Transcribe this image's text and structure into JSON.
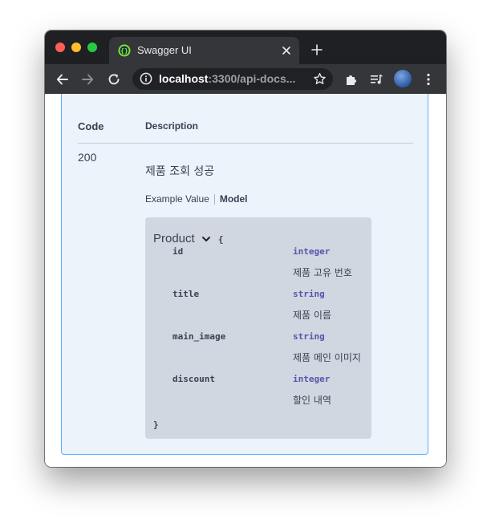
{
  "browser": {
    "tab_title": "Swagger UI",
    "url_host": "localhost",
    "url_path": ":3300/api-docs..."
  },
  "responses": {
    "header_code": "Code",
    "header_description": "Description",
    "status_code": "200",
    "description": "제품 조회 성공",
    "tab_example": "Example Value",
    "tab_model": "Model"
  },
  "model": {
    "name": "Product",
    "open_brace": "{",
    "close_brace": "}",
    "properties": [
      {
        "name": "id",
        "type": "integer",
        "description": "제품 고유 번호"
      },
      {
        "name": "title",
        "type": "string",
        "description": "제품 이름"
      },
      {
        "name": "main_image",
        "type": "string",
        "description": "제품 메인 이미지"
      },
      {
        "name": "discount",
        "type": "integer",
        "description": "할인 내역"
      }
    ]
  },
  "colors": {
    "accent_border": "#61affe",
    "panel_bg": "#ebf3fb",
    "model_bg": "#d1d7e0",
    "type_color": "#5555aa"
  }
}
